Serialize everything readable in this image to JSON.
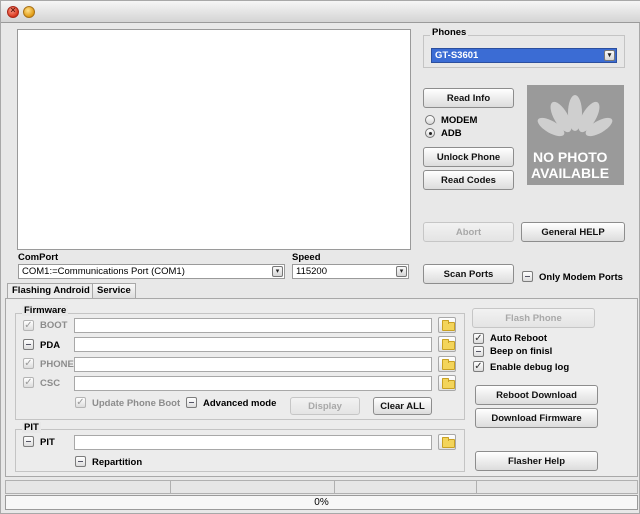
{
  "titlebar": {
    "title": ""
  },
  "phones": {
    "label": "Phones",
    "selected": "GT-S3601"
  },
  "buttons": {
    "read_info": "Read Info",
    "unlock_phone": "Unlock Phone",
    "read_codes": "Read Codes",
    "abort": "Abort",
    "general_help": "General HELP",
    "scan_ports": "Scan Ports",
    "flash_phone": "Flash Phone",
    "reboot_download": "Reboot Download",
    "download_firmware": "Download Firmware",
    "flasher_help": "Flasher Help",
    "display": "Display",
    "clear_all": "Clear ALL"
  },
  "mode": {
    "modem": "MODEM",
    "adb": "ADB",
    "selected": "ADB"
  },
  "no_photo": {
    "line1": "NO PHOTO",
    "line2": "AVAILABLE"
  },
  "comport": {
    "label": "ComPort",
    "selected": "COM1:=Communications Port (COM1)"
  },
  "speed": {
    "label": "Speed",
    "selected": "115200"
  },
  "only_modem_ports": "Only Modem Ports",
  "tabs": [
    {
      "label": "Flashing Android",
      "active": true
    },
    {
      "label": "Service",
      "active": false
    }
  ],
  "firmware": {
    "label": "Firmware",
    "rows": [
      {
        "label": "BOOT",
        "checked": true,
        "enabled": false,
        "value": ""
      },
      {
        "label": "PDA",
        "checked": false,
        "enabled": true,
        "value": ""
      },
      {
        "label": "PHONE",
        "checked": true,
        "enabled": false,
        "value": ""
      },
      {
        "label": "CSC",
        "checked": true,
        "enabled": false,
        "value": ""
      }
    ],
    "update_phone_boot": "Update Phone Boot",
    "advanced_mode": "Advanced mode"
  },
  "pit": {
    "label": "PIT",
    "row_label": "PIT",
    "value": "",
    "repartition": "Repartition"
  },
  "options": {
    "auto_reboot": {
      "label": "Auto Reboot",
      "checked": true
    },
    "beep_on_finish": {
      "label": "Beep on finisl",
      "checked": false
    },
    "enable_debug_log": {
      "label": "Enable debug log",
      "checked": true
    }
  },
  "progress": {
    "value": 0,
    "text": "0%"
  },
  "colors": {
    "selection": "#3a6fd8",
    "accent": "#3b6cd4"
  }
}
